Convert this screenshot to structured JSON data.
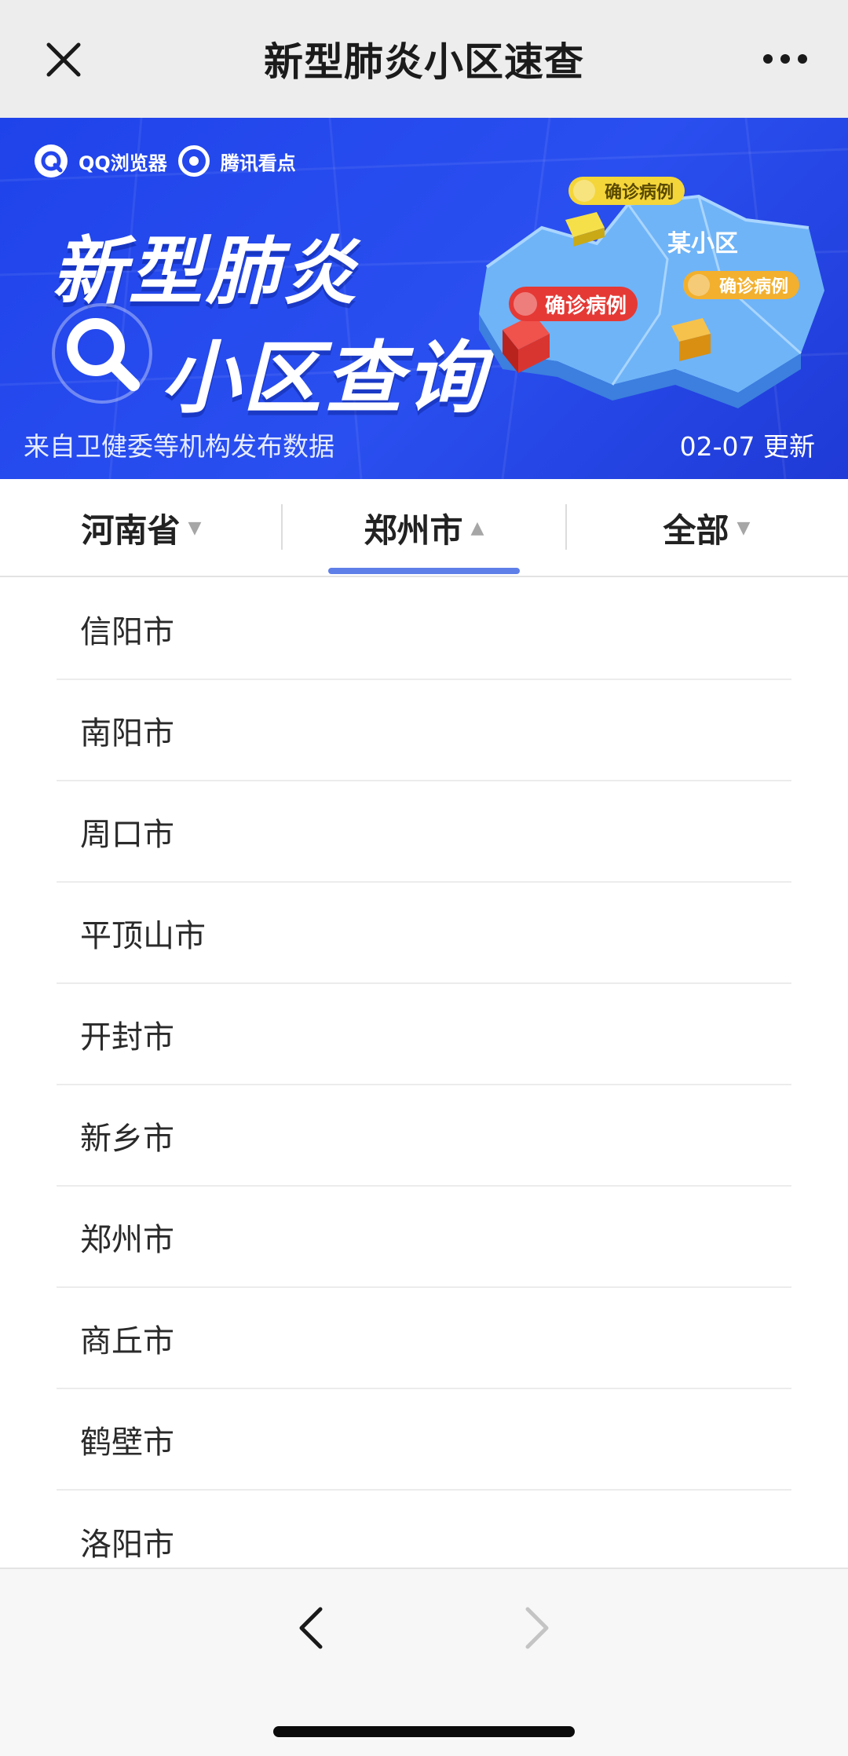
{
  "navbar": {
    "title": "新型肺炎小区速查",
    "close_icon": "close-icon",
    "more_icon": "more-icon"
  },
  "banner": {
    "brand_qq": "QQ浏览器",
    "brand_news": "腾讯看点",
    "headline_line1": "新型肺炎",
    "headline_line2": "小区查询",
    "source": "来自卫健委等机构发布数据",
    "update": "02-07 更新",
    "map_label": "某小区",
    "tag_confirmed": "确诊病例",
    "colors": {
      "background": "#2446ec",
      "red_tag": "#e53935",
      "yellow_tag": "#f4d63a",
      "orange_tag": "#f2b02e"
    }
  },
  "filters": {
    "province": "河南省",
    "city": "郑州市",
    "district": "全部",
    "active_color": "#5f7fe8"
  },
  "cities": [
    "信阳市",
    "南阳市",
    "周口市",
    "平顶山市",
    "开封市",
    "新乡市",
    "郑州市",
    "商丘市",
    "鹤壁市",
    "洛阳市"
  ],
  "bottom_bar": {
    "back_icon": "chevron-left-icon",
    "forward_icon": "chevron-right-icon"
  }
}
